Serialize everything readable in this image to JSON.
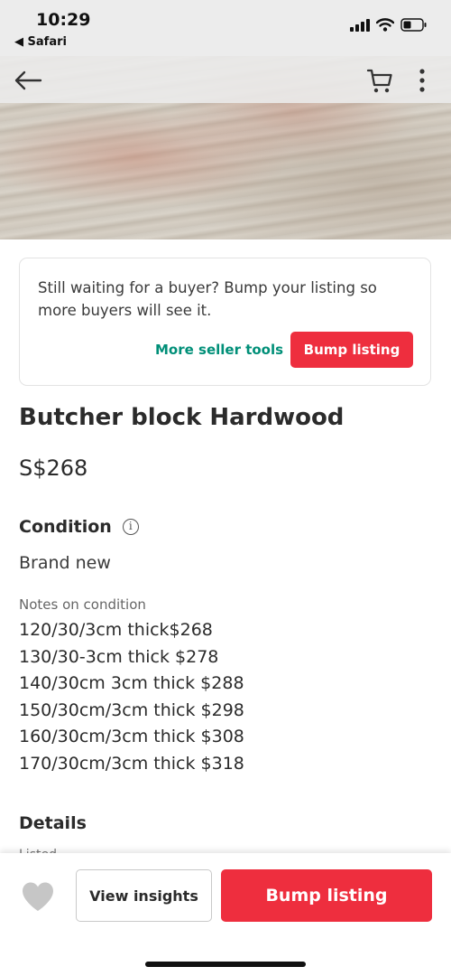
{
  "status_bar": {
    "time": "10:29",
    "back_app": "◀ Safari",
    "icons": [
      "signal-icon",
      "wifi-icon",
      "battery-icon"
    ]
  },
  "nav": {
    "icons": [
      "back-arrow-icon",
      "cart-icon",
      "more-vertical-icon"
    ]
  },
  "bump_card": {
    "message": "Still waiting for a buyer? Bump your listing so more buyers will see it.",
    "more_tools_label": "More seller tools",
    "bump_label": "Bump listing"
  },
  "listing": {
    "title": "Butcher block Hardwood",
    "price": "S$268",
    "condition_heading": "Condition",
    "condition_value": "Brand new",
    "notes_label": "Notes on condition",
    "notes": [
      "120/30/3cm thick$268",
      "130/30-3cm thick $278",
      "140/30cm 3cm thick $288",
      "150/30cm/3cm thick $298",
      "160/30cm/3cm thick $308",
      "170/30cm/3cm thick $318"
    ],
    "details_heading": "Details",
    "details_listed": "Listed"
  },
  "bottom_bar": {
    "insights_label": "View insights",
    "bump_label": "Bump listing"
  },
  "colors": {
    "accent_red": "#ee2e3e",
    "accent_green": "#008f78"
  }
}
